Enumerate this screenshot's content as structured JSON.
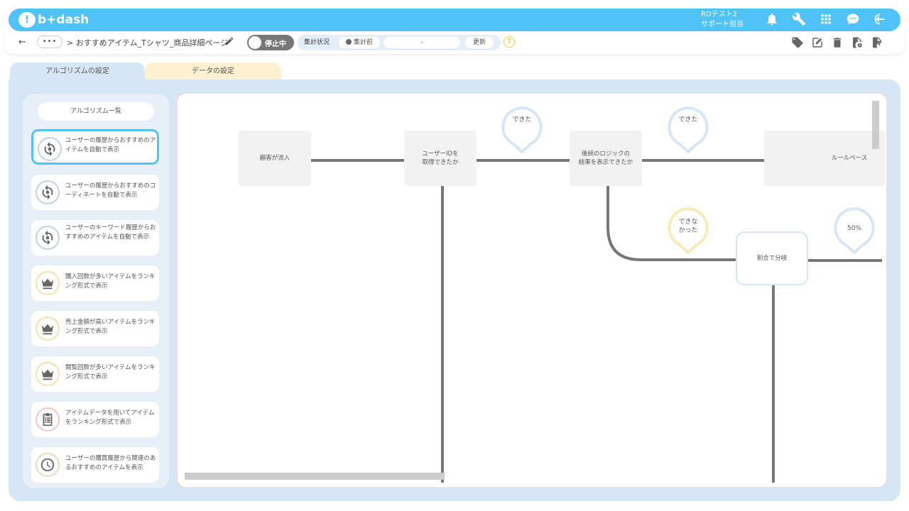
{
  "app": {
    "logo_text": "b+dash",
    "user_name": "RDテスト2",
    "user_role": "サポート担当"
  },
  "subbar": {
    "back": "←",
    "more": "•••",
    "breadcrumb": "> おすすめアイテム_Tシャツ_商品詳細ページ",
    "toggle_label": "停止中",
    "status_label": "集計状況",
    "status_state": "集計前",
    "status_value": "-",
    "update_label": "更新",
    "help": "?"
  },
  "tabs": {
    "algorithm": "アルゴリズムの設定",
    "data": "データの設定"
  },
  "sidebar": {
    "title": "アルゴリズム一覧",
    "items": [
      {
        "label": "ユーザーの履歴からおすすめのアイテムを自動で表示",
        "icon": "sync-gear-icon"
      },
      {
        "label": "ユーザーの履歴からおすすめのコーディネートを自動で表示",
        "icon": "sync-gear-icon"
      },
      {
        "label": "ユーザーのキーワード履歴からおすすめのアイテムを自動で表示",
        "icon": "sync-gear-icon"
      },
      {
        "label": "購入回数が多いアイテムをランキング形式で表示",
        "icon": "crown-icon"
      },
      {
        "label": "売上金額が高いアイテムをランキング形式で表示",
        "icon": "crown-icon"
      },
      {
        "label": "閲覧回数が多いアイテムをランキング形式で表示",
        "icon": "crown-icon"
      },
      {
        "label": "アイテムデータを用いてアイテムをランキング形式で表示",
        "icon": "clipboard-list-icon"
      },
      {
        "label": "ユーザーの購買履歴から関連のあるおすすめのアイテムを表示",
        "icon": "clock-icon"
      }
    ]
  },
  "flow": {
    "node_customer": "顧客が流入",
    "node_userid": "ユーザーIDを\n取得できたか",
    "node_logic": "後続のロジックの\n結果を表示できたか",
    "node_rule": "ルールベース",
    "node_split": "割合で分岐",
    "pin_yes_1": "できた",
    "pin_yes_2": "できた",
    "pin_no": "できな\nかった",
    "pin_percent": "50%"
  },
  "colors": {
    "accent": "#4fc3f7",
    "panel": "#d6e6f4",
    "data_tab": "#fdf1d2",
    "connector": "#777777"
  }
}
